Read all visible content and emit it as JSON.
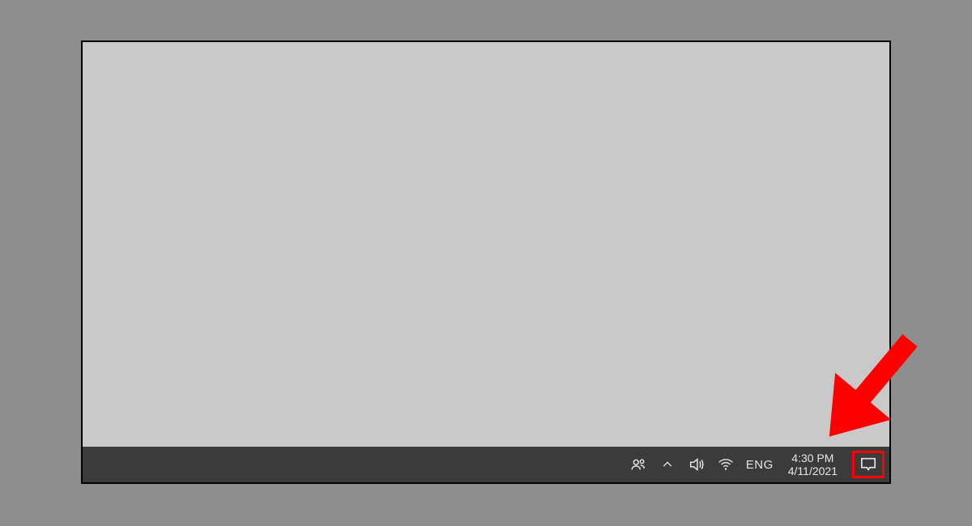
{
  "taskbar": {
    "language": "ENG",
    "time": "4:30 PM",
    "date": "4/11/2021"
  },
  "icons": {
    "people": "people-icon",
    "tray_overflow": "chevron-up-icon",
    "volume": "speaker-icon",
    "wifi": "wifi-icon",
    "action_center": "action-center-icon"
  },
  "annotation": {
    "highlight_target": "action-center-button"
  }
}
